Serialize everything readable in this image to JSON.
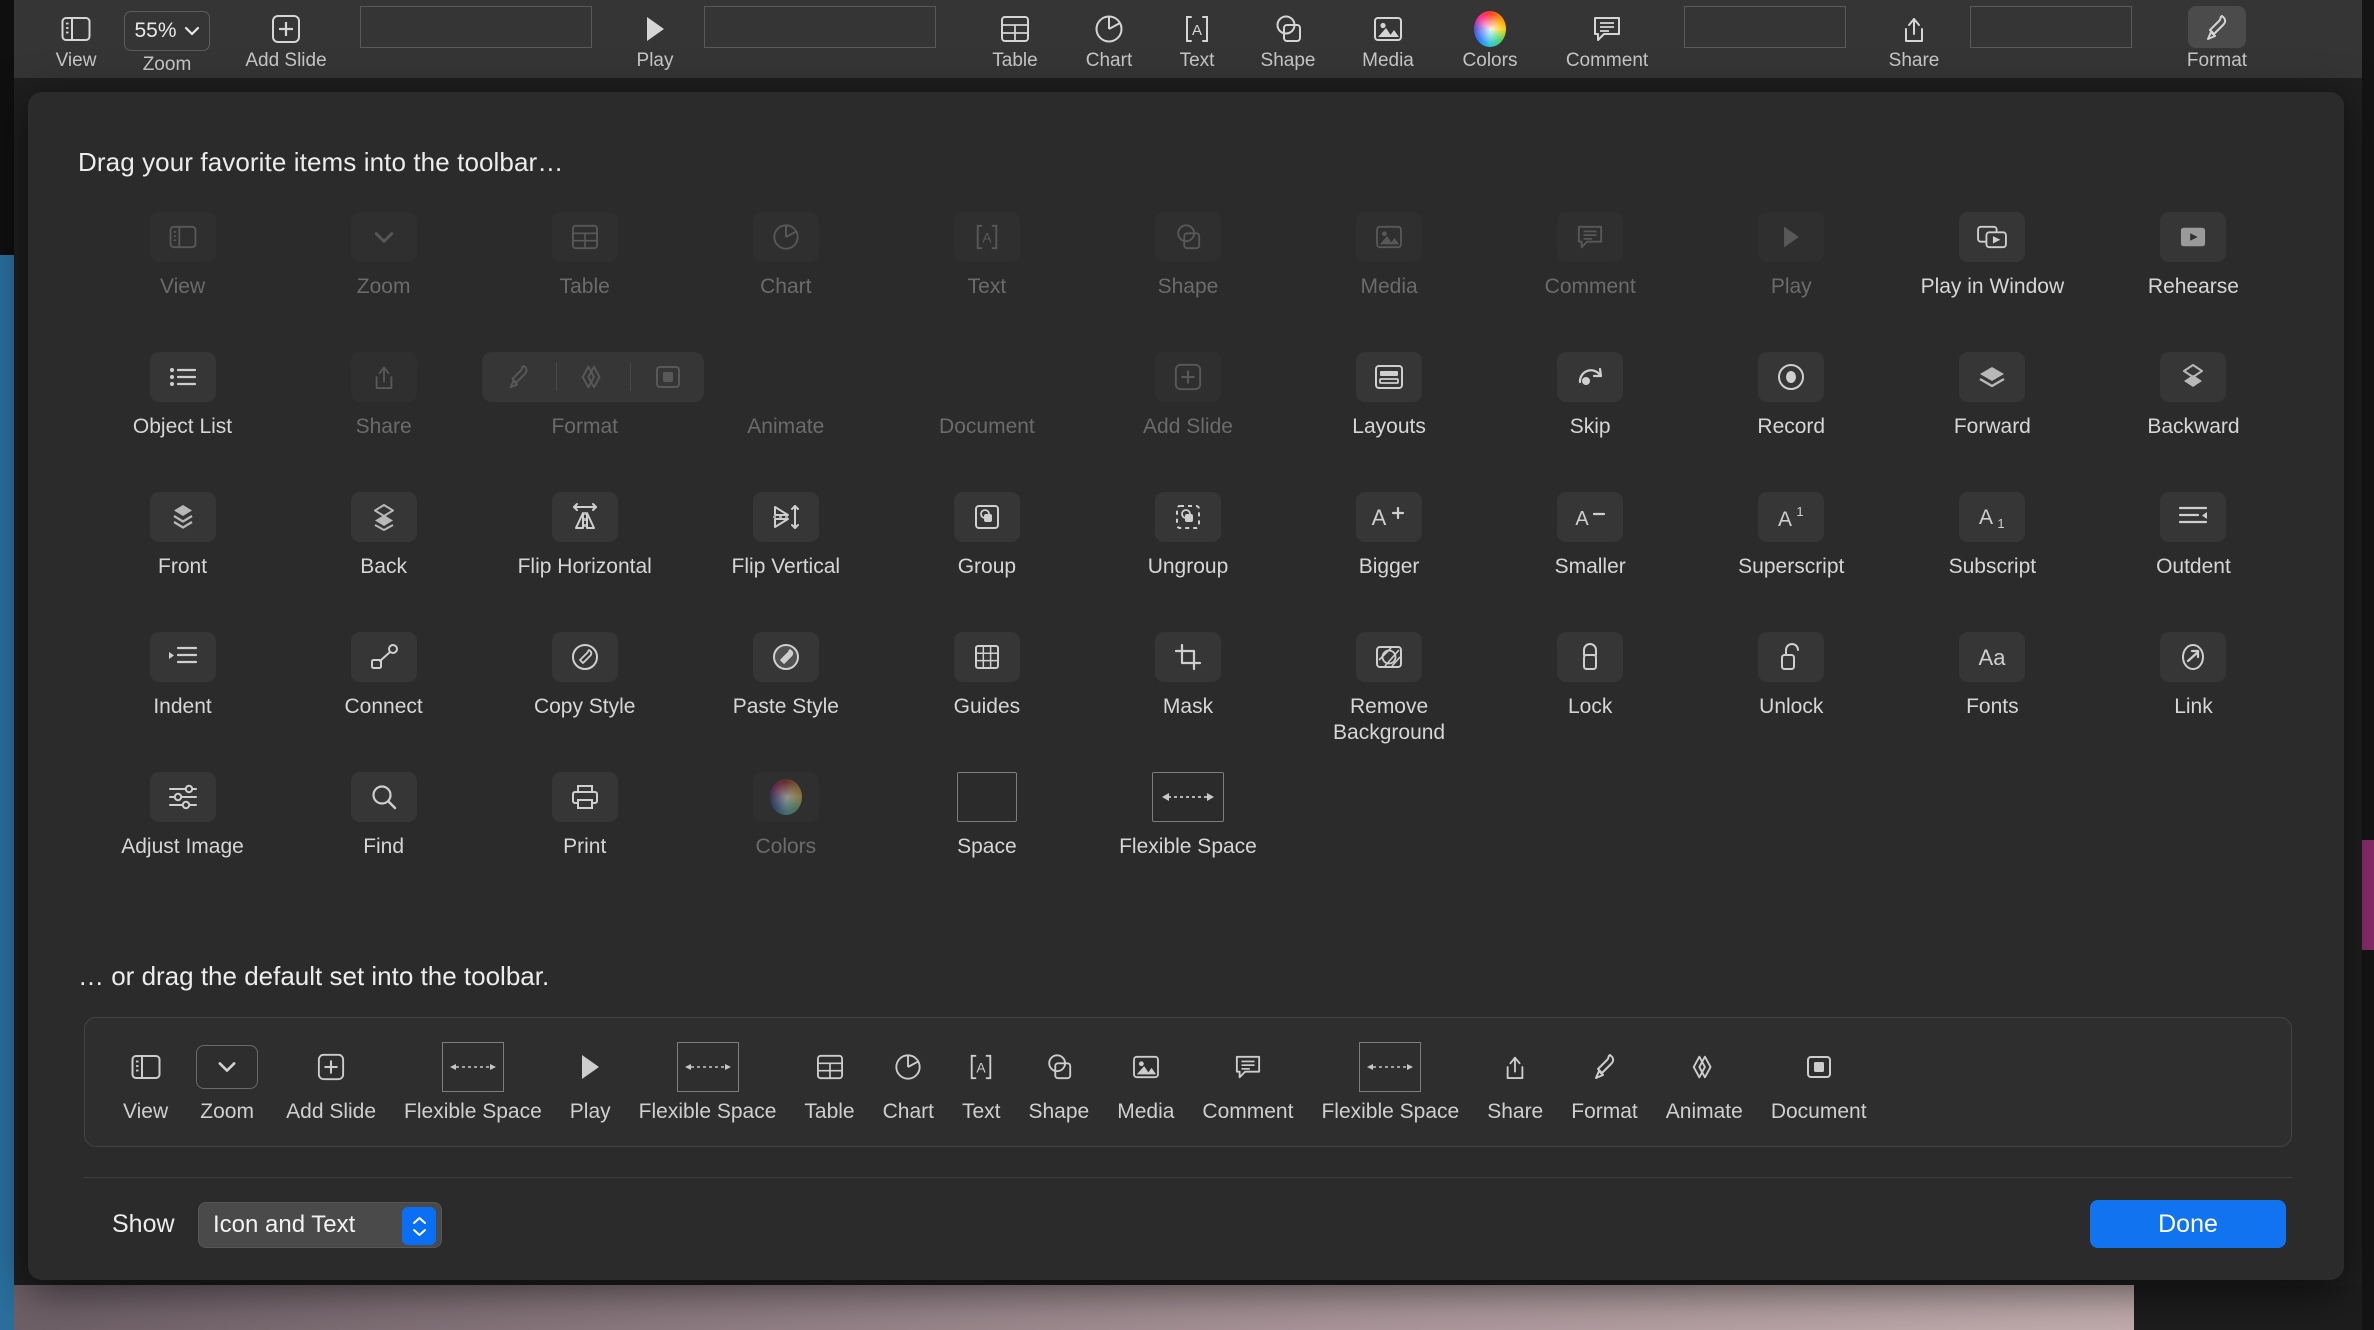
{
  "window": {
    "toolbar": {
      "items": [
        {
          "name": "view",
          "label": "View",
          "icon": "sidebar-icon"
        },
        {
          "name": "zoom",
          "label": "Zoom",
          "icon": "chevron-down-icon",
          "value": "55%"
        },
        {
          "name": "add-slide",
          "label": "Add Slide",
          "icon": "plus-square-icon"
        },
        {
          "name": "flexible-space-1",
          "label": "",
          "icon": "flexible-space-icon"
        },
        {
          "name": "play",
          "label": "Play",
          "icon": "play-icon"
        },
        {
          "name": "flexible-space-2",
          "label": "",
          "icon": "flexible-space-icon"
        },
        {
          "name": "table",
          "label": "Table",
          "icon": "table-icon"
        },
        {
          "name": "chart",
          "label": "Chart",
          "icon": "chart-icon"
        },
        {
          "name": "text",
          "label": "Text",
          "icon": "text-icon"
        },
        {
          "name": "shape",
          "label": "Shape",
          "icon": "shape-icon"
        },
        {
          "name": "media",
          "label": "Media",
          "icon": "media-icon"
        },
        {
          "name": "colors",
          "label": "Colors",
          "icon": "color-wheel-icon"
        },
        {
          "name": "comment",
          "label": "Comment",
          "icon": "comment-icon"
        },
        {
          "name": "flexible-space-3",
          "label": "",
          "icon": "flexible-space-icon"
        },
        {
          "name": "share",
          "label": "Share",
          "icon": "share-icon"
        },
        {
          "name": "flexible-space-4",
          "label": "",
          "icon": "flexible-space-icon"
        },
        {
          "name": "format",
          "label": "Format",
          "icon": "format-brush-icon"
        }
      ]
    }
  },
  "sheet": {
    "title": "Drag your favorite items into the toolbar…",
    "subtitle": "… or drag the default set into the toolbar.",
    "palette": [
      {
        "label": "View",
        "icon": "sidebar-icon",
        "dim": true
      },
      {
        "label": "Zoom",
        "icon": "chevron-down-icon",
        "dim": true
      },
      {
        "label": "Table",
        "icon": "table-icon",
        "dim": true
      },
      {
        "label": "Chart",
        "icon": "chart-icon",
        "dim": true
      },
      {
        "label": "Text",
        "icon": "text-icon",
        "dim": true
      },
      {
        "label": "Shape",
        "icon": "shape-icon",
        "dim": true
      },
      {
        "label": "Media",
        "icon": "media-icon",
        "dim": true
      },
      {
        "label": "Comment",
        "icon": "comment-icon",
        "dim": true
      },
      {
        "label": "Play",
        "icon": "play-icon",
        "dim": true
      },
      {
        "label": "Play in Window",
        "icon": "play-in-window-icon",
        "dim": false
      },
      {
        "label": "Rehearse",
        "icon": "rehearse-icon",
        "dim": false
      },
      {
        "label": "Object List",
        "icon": "object-list-icon",
        "dim": false
      },
      {
        "label": "Share",
        "icon": "share-icon",
        "dim": true
      },
      {
        "label": "Format",
        "icon": "format-brush-icon",
        "dim": true,
        "group": "fad"
      },
      {
        "label": "Animate",
        "icon": "animate-icon",
        "dim": true,
        "group": "fad"
      },
      {
        "label": "Document",
        "icon": "document-icon",
        "dim": true,
        "group": "fad"
      },
      {
        "label": "Add Slide",
        "icon": "plus-square-icon",
        "dim": true
      },
      {
        "label": "Layouts",
        "icon": "layouts-icon",
        "dim": false
      },
      {
        "label": "Skip",
        "icon": "skip-icon",
        "dim": false
      },
      {
        "label": "Record",
        "icon": "record-icon",
        "dim": false
      },
      {
        "label": "Forward",
        "icon": "forward-icon",
        "dim": false
      },
      {
        "label": "Backward",
        "icon": "backward-icon",
        "dim": false
      },
      {
        "label": "Front",
        "icon": "front-icon",
        "dim": false
      },
      {
        "label": "Back",
        "icon": "back-icon",
        "dim": false
      },
      {
        "label": "Flip Horizontal",
        "icon": "flip-horizontal-icon",
        "dim": false
      },
      {
        "label": "Flip Vertical",
        "icon": "flip-vertical-icon",
        "dim": false
      },
      {
        "label": "Group",
        "icon": "group-icon",
        "dim": false
      },
      {
        "label": "Ungroup",
        "icon": "ungroup-icon",
        "dim": false
      },
      {
        "label": "Bigger",
        "icon": "bigger-text-icon",
        "dim": false
      },
      {
        "label": "Smaller",
        "icon": "smaller-text-icon",
        "dim": false
      },
      {
        "label": "Superscript",
        "icon": "superscript-icon",
        "dim": false
      },
      {
        "label": "Subscript",
        "icon": "subscript-icon",
        "dim": false
      },
      {
        "label": "Outdent",
        "icon": "outdent-icon",
        "dim": false
      },
      {
        "label": "Indent",
        "icon": "indent-icon",
        "dim": false
      },
      {
        "label": "Connect",
        "icon": "connect-icon",
        "dim": false
      },
      {
        "label": "Copy Style",
        "icon": "copy-style-icon",
        "dim": false
      },
      {
        "label": "Paste Style",
        "icon": "paste-style-icon",
        "dim": false
      },
      {
        "label": "Guides",
        "icon": "guides-icon",
        "dim": false
      },
      {
        "label": "Mask",
        "icon": "mask-icon",
        "dim": false
      },
      {
        "label": "Remove Background",
        "icon": "remove-background-icon",
        "dim": false
      },
      {
        "label": "Lock",
        "icon": "lock-icon",
        "dim": false
      },
      {
        "label": "Unlock",
        "icon": "unlock-icon",
        "dim": false
      },
      {
        "label": "Fonts",
        "icon": "fonts-icon",
        "dim": false
      },
      {
        "label": "Link",
        "icon": "link-icon",
        "dim": false
      },
      {
        "label": "Adjust Image",
        "icon": "adjust-image-icon",
        "dim": false
      },
      {
        "label": "Find",
        "icon": "search-icon",
        "dim": false
      },
      {
        "label": "Print",
        "icon": "print-icon",
        "dim": false
      },
      {
        "label": "Colors",
        "icon": "color-wheel-icon",
        "dim": true
      },
      {
        "label": "Space",
        "icon": "space-icon",
        "dim": false
      },
      {
        "label": "Flexible Space",
        "icon": "flexible-space-icon",
        "dim": false
      }
    ],
    "default_set": [
      {
        "label": "View",
        "icon": "sidebar-icon"
      },
      {
        "label": "Zoom",
        "icon": "chevron-down-icon"
      },
      {
        "label": "Add Slide",
        "icon": "plus-square-icon"
      },
      {
        "label": "Flexible Space",
        "icon": "flexible-space-icon"
      },
      {
        "label": "Play",
        "icon": "play-icon"
      },
      {
        "label": "Flexible Space",
        "icon": "flexible-space-icon"
      },
      {
        "label": "Table",
        "icon": "table-icon"
      },
      {
        "label": "Chart",
        "icon": "chart-icon"
      },
      {
        "label": "Text",
        "icon": "text-icon"
      },
      {
        "label": "Shape",
        "icon": "shape-icon"
      },
      {
        "label": "Media",
        "icon": "media-icon"
      },
      {
        "label": "Comment",
        "icon": "comment-icon"
      },
      {
        "label": "Flexible Space",
        "icon": "flexible-space-icon"
      },
      {
        "label": "Share",
        "icon": "share-icon"
      },
      {
        "label": "Format",
        "icon": "format-brush-icon"
      },
      {
        "label": "Animate",
        "icon": "animate-icon"
      },
      {
        "label": "Document",
        "icon": "document-icon"
      }
    ],
    "footer": {
      "show_label": "Show",
      "show_value": "Icon and Text",
      "done_label": "Done"
    }
  },
  "colors": {
    "accent": "#1173f0",
    "sheet_bg": "#2b2b2b",
    "toolbar_bg": "#353535",
    "text": "#ececec",
    "text_dim": "#6b6b6b"
  }
}
